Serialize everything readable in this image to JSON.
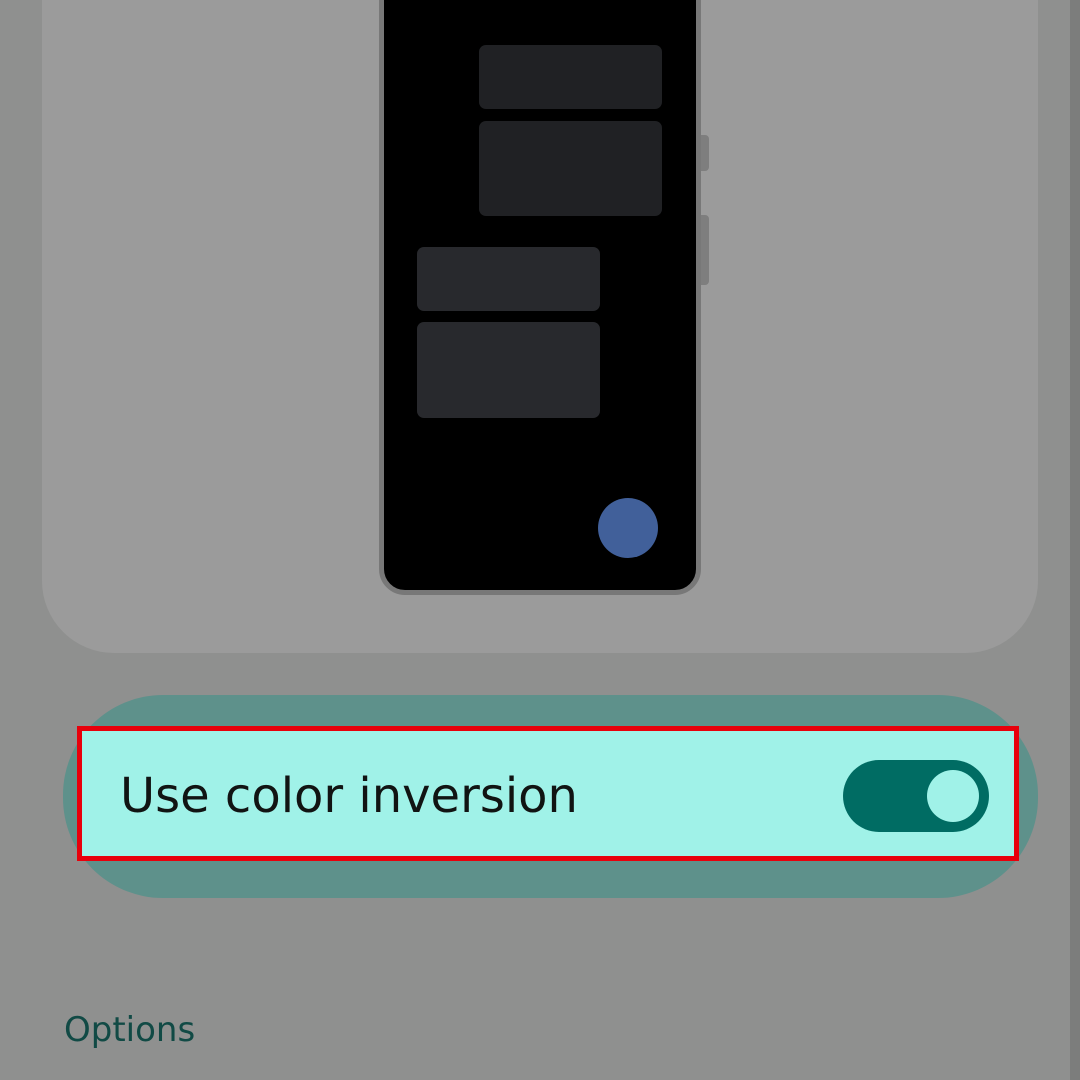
{
  "preview": {
    "phone_mockup": "dark-theme-phone-illustration",
    "fab_color": "#41609a"
  },
  "toggle": {
    "label": "Use color inversion",
    "checked": true,
    "accent_color": "#006c63",
    "row_color": "#a0f2e8",
    "highlight_border_color": "#e8000b"
  },
  "options_section": {
    "title": "Options"
  }
}
